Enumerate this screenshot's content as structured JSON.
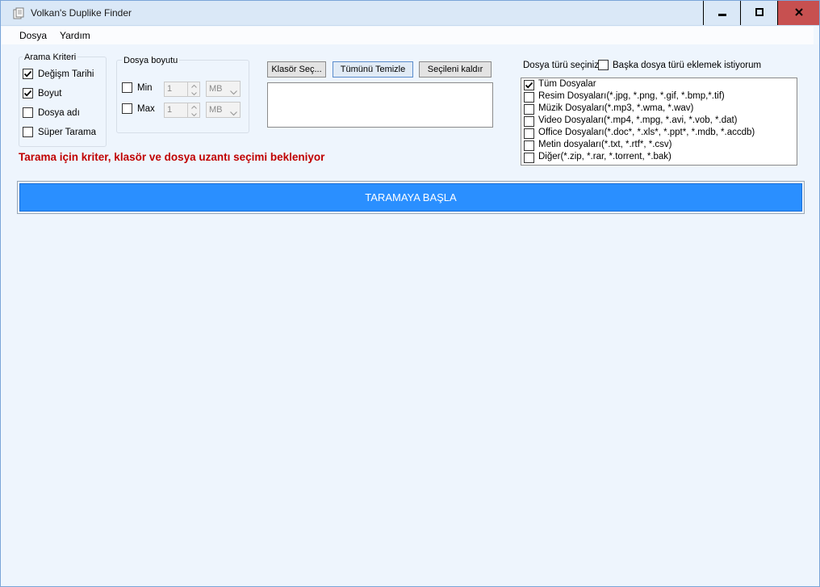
{
  "window": {
    "title": "Volkan's Duplike Finder",
    "app_icon": "documents-icon",
    "controls": [
      "minimize-icon",
      "maximize-icon",
      "close-icon"
    ]
  },
  "menu": {
    "items": [
      {
        "label": "Dosya"
      },
      {
        "label": "Yardım"
      }
    ]
  },
  "criteria": {
    "legend": "Arama Kriteri",
    "items": [
      {
        "label": "Değişm Tarihi",
        "checked": true
      },
      {
        "label": "Boyut",
        "checked": true
      },
      {
        "label": "Dosya adı",
        "checked": false
      },
      {
        "label": "Süper Tarama",
        "checked": false
      }
    ]
  },
  "size": {
    "legend": "Dosya boyutu",
    "min": {
      "label": "Min",
      "checked": false,
      "value": "1",
      "unit": "MB"
    },
    "max": {
      "label": "Max",
      "checked": false,
      "value": "1",
      "unit": "MB"
    }
  },
  "folder": {
    "select_label": "Klasör Seç...",
    "clear_all_label": "Tümünü Temizle",
    "remove_selected_label": "Seçileni kaldır"
  },
  "filetypes": {
    "label": "Dosya türü seçiniz",
    "extra_label": "Başka dosya türü eklemek istiyorum",
    "extra_checked": false,
    "items": [
      {
        "label": "Tüm Dosyalar",
        "checked": true
      },
      {
        "label": "Resim Dosyaları(*.jpg, *.png, *.gif, *.bmp,*.tif)",
        "checked": false
      },
      {
        "label": "Müzik Dosyaları(*.mp3, *.wma, *.wav)",
        "checked": false
      },
      {
        "label": "Video Dosyaları(*.mp4, *.mpg, *.avi, *.vob, *.dat)",
        "checked": false
      },
      {
        "label": "Office Dosyaları(*.doc*, *.xls*, *.ppt*, *.mdb, *.accdb)",
        "checked": false
      },
      {
        "label": "Metin dosyaları(*.txt, *.rtf*, *.csv)",
        "checked": false
      },
      {
        "label": "Diğer(*.zip, *.rar, *.torrent, *.bak)",
        "checked": false
      }
    ]
  },
  "status": {
    "message": "Tarama için kriter, klasör ve dosya uzantı seçimi bekleniyor",
    "color": "#c00000"
  },
  "start": {
    "label": "TARAMAYA BAŞLA",
    "color": "#2a8fff"
  }
}
